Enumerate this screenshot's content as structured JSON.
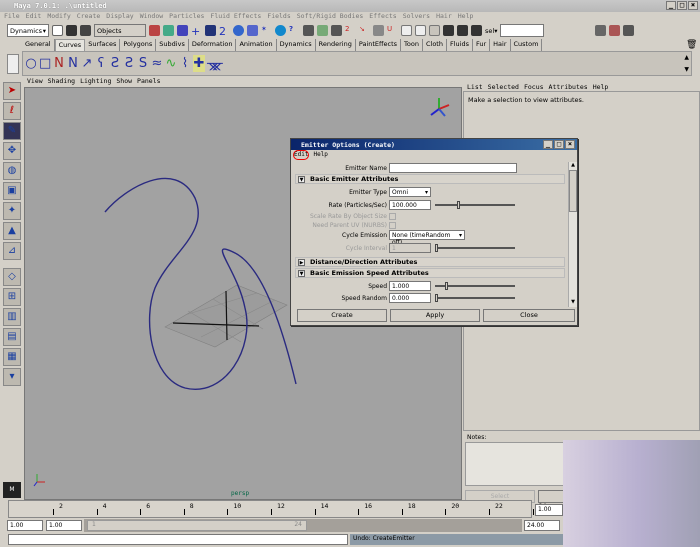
{
  "window": {
    "title": "Maya 7.0.1: .\\untitled",
    "buttons": [
      "_",
      "□",
      "×"
    ]
  },
  "menubar": [
    "File",
    "Edit",
    "Modify",
    "Create",
    "Display",
    "Window",
    "Particles",
    "Fluid Effects",
    "Fields",
    "Soft/Rigid Bodies",
    "Effects",
    "Solvers",
    "Hair",
    "Help"
  ],
  "toolbar": {
    "menuset": "Dynamics",
    "selection_mode": "Objects",
    "sel_label": "sel▾",
    "sel_value": ""
  },
  "shelf_tabs": [
    "General",
    "Curves",
    "Surfaces",
    "Polygons",
    "Subdivs",
    "Deformation",
    "Animation",
    "Dynamics",
    "Rendering",
    "PaintEffects",
    "Toon",
    "Cloth",
    "Fluids",
    "Fur",
    "Hair",
    "Custom"
  ],
  "shelf_active": "Curves",
  "viewport": {
    "menu": [
      "View",
      "Shading",
      "Lighting",
      "Show",
      "Panels"
    ],
    "camera_label": "persp"
  },
  "attr_panel": {
    "menu": [
      "List",
      "Selected",
      "Focus",
      "Attributes",
      "Help"
    ],
    "message": "Make a selection to view attributes.",
    "notes_label": "Notes:",
    "select_button": "Select",
    "load_button": "L"
  },
  "dialog": {
    "title": "Emitter Options (Create)",
    "menu": [
      "Edit",
      "Help"
    ],
    "emitter_name_label": "Emitter Name",
    "emitter_name": "",
    "sections": {
      "basic": "Basic Emitter Attributes",
      "distance": "Distance/Direction Attributes",
      "speed": "Basic Emission Speed Attributes"
    },
    "emitter_type_label": "Emitter Type",
    "emitter_type": "Omni",
    "rate_label": "Rate (Particles/Sec)",
    "rate": "100.000",
    "rate_slider": 0.3,
    "scale_rate_label": "Scale Rate By Object Size",
    "need_parent_label": "Need Parent UV (NURBS)",
    "cycle_emission_label": "Cycle Emission",
    "cycle_emission": "None (timeRandom off)",
    "cycle_interval_label": "Cycle Interval",
    "cycle_interval": "1",
    "speed_label": "Speed",
    "speed": "1.000",
    "speed_random_label": "Speed Random",
    "speed_random": "0.000",
    "buttons": {
      "create": "Create",
      "apply": "Apply",
      "close": "Close"
    }
  },
  "timeline": {
    "ticks": [
      "2",
      "4",
      "6",
      "8",
      "10",
      "12",
      "14",
      "16",
      "18",
      "20",
      "22",
      "24"
    ],
    "current_time": "1.00"
  },
  "range": {
    "start": "1.00",
    "playback_start": "1.00",
    "slider_start": "1",
    "slider_end": "24",
    "playback_end": "24.00"
  },
  "command": {
    "input": "",
    "feedback": "Undo: CreateEmitter"
  }
}
